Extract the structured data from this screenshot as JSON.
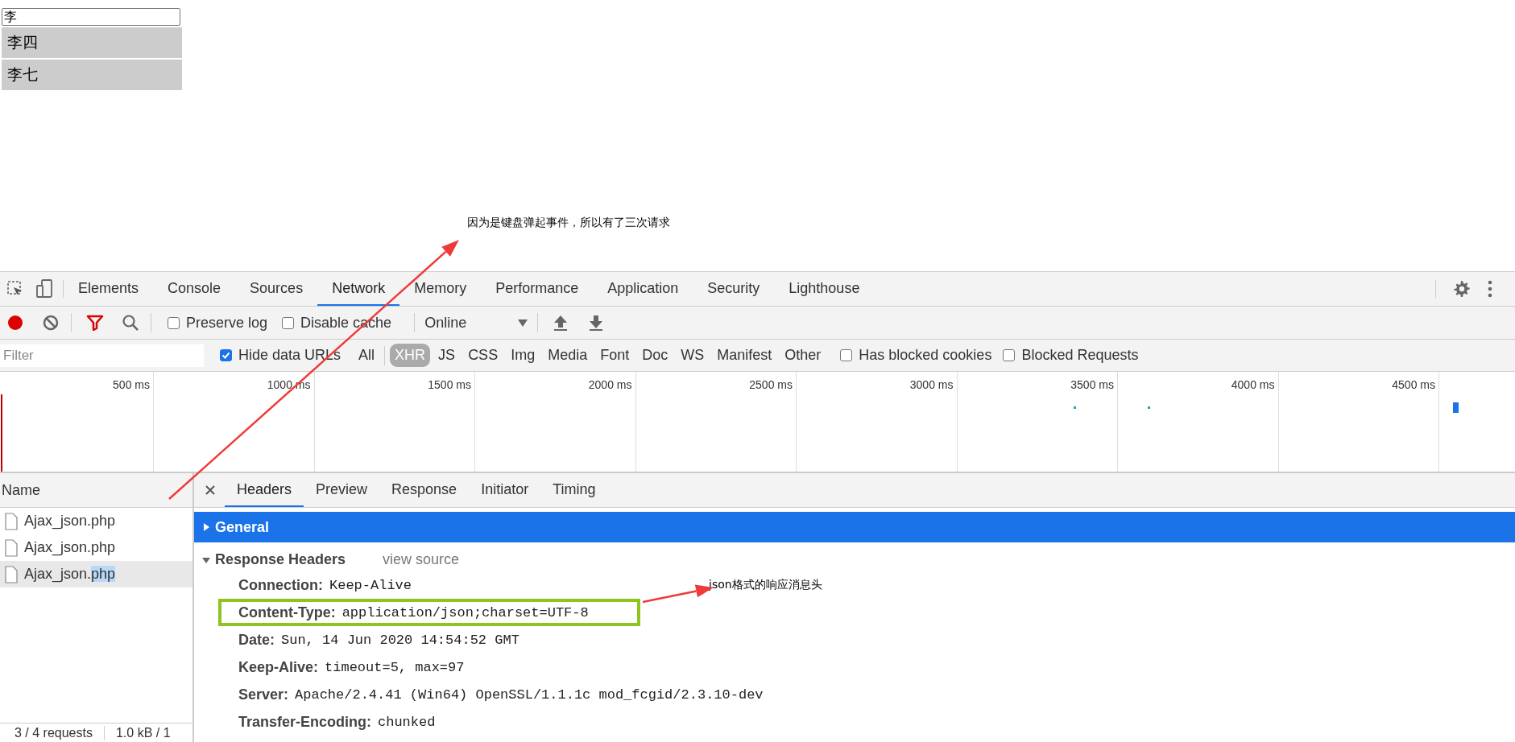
{
  "page": {
    "search": {
      "value": "李"
    },
    "suggestions": [
      {
        "text": "李四"
      },
      {
        "text": "李七"
      }
    ]
  },
  "annotations": [
    {
      "text": "因为是键盘弹起事件，所以有了三次请求"
    },
    {
      "text": "json格式的响应消息头"
    }
  ],
  "devtools": {
    "tabs": [
      {
        "label": "Elements",
        "selected": false
      },
      {
        "label": "Console",
        "selected": false
      },
      {
        "label": "Sources",
        "selected": false
      },
      {
        "label": "Network",
        "selected": true
      },
      {
        "label": "Memory",
        "selected": false
      },
      {
        "label": "Performance",
        "selected": false
      },
      {
        "label": "Application",
        "selected": false
      },
      {
        "label": "Security",
        "selected": false
      },
      {
        "label": "Lighthouse",
        "selected": false
      }
    ],
    "toolbar": {
      "recording": true,
      "preserve_log": {
        "label": "Preserve log",
        "checked": false
      },
      "disable_cache": {
        "label": "Disable cache",
        "checked": false
      },
      "throttling": "Online"
    },
    "filter_bar": {
      "placeholder": "Filter",
      "hide_data_urls": {
        "label": "Hide data URLs",
        "checked": true
      },
      "types": [
        {
          "label": "All",
          "selected": false
        },
        {
          "label": "XHR",
          "selected": true
        },
        {
          "label": "JS",
          "selected": false
        },
        {
          "label": "CSS",
          "selected": false
        },
        {
          "label": "Img",
          "selected": false
        },
        {
          "label": "Media",
          "selected": false
        },
        {
          "label": "Font",
          "selected": false
        },
        {
          "label": "Doc",
          "selected": false
        },
        {
          "label": "WS",
          "selected": false
        },
        {
          "label": "Manifest",
          "selected": false
        },
        {
          "label": "Other",
          "selected": false
        }
      ],
      "has_blocked_cookies": {
        "label": "Has blocked cookies",
        "checked": false
      },
      "blocked_requests": {
        "label": "Blocked Requests",
        "checked": false
      }
    },
    "timeline": {
      "ticks": [
        "500 ms",
        "1000 ms",
        "1500 ms",
        "2000 ms",
        "2500 ms",
        "3000 ms",
        "3500 ms",
        "4000 ms",
        "4500 ms"
      ]
    },
    "requests": {
      "column": "Name",
      "rows": [
        {
          "name": "Ajax_json.php",
          "selected": false
        },
        {
          "name": "Ajax_json.php",
          "selected": false
        },
        {
          "name": "Ajax_json.",
          "selected_text": "php",
          "selected": true
        }
      ]
    },
    "detail": {
      "tabs": [
        {
          "label": "Headers",
          "selected": true
        },
        {
          "label": "Preview",
          "selected": false
        },
        {
          "label": "Response",
          "selected": false
        },
        {
          "label": "Initiator",
          "selected": false
        },
        {
          "label": "Timing",
          "selected": false
        }
      ],
      "general": {
        "label": "General",
        "expanded": false
      },
      "response_headers": {
        "label": "Response Headers",
        "expanded": true,
        "view_source": "view source",
        "headers": [
          {
            "name": "Connection:",
            "value": "Keep-Alive",
            "highlighted": false
          },
          {
            "name": "Content-Type:",
            "value": "application/json;charset=UTF-8",
            "highlighted": true
          },
          {
            "name": "Date:",
            "value": "Sun, 14 Jun 2020 14:54:52 GMT",
            "highlighted": false
          },
          {
            "name": "Keep-Alive:",
            "value": "timeout=5, max=97",
            "highlighted": false
          },
          {
            "name": "Server:",
            "value": "Apache/2.4.41 (Win64) OpenSSL/1.1.1c mod_fcgid/2.3.10-dev",
            "highlighted": false
          },
          {
            "name": "Transfer-Encoding:",
            "value": "chunked",
            "highlighted": false
          }
        ]
      }
    },
    "status_bar": [
      "3 / 4 requests",
      "1.0 kB / 1"
    ]
  }
}
